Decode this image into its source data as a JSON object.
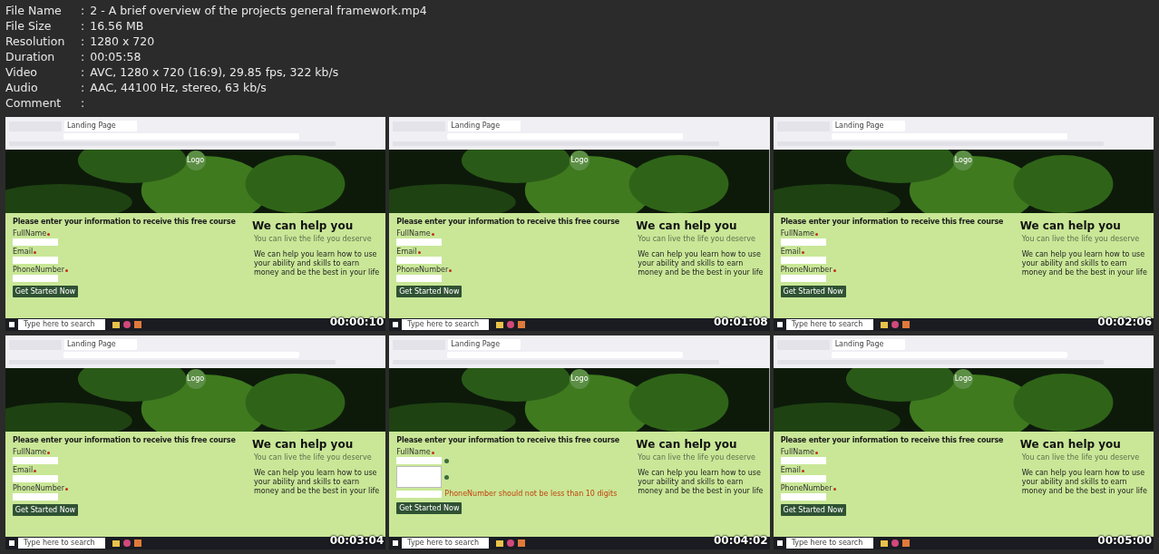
{
  "info": [
    {
      "label": "File Name",
      "sep": ":",
      "value": "2 - A brief overview of the projects general framework.mp4"
    },
    {
      "label": "File Size",
      "sep": ":",
      "value": "16.56 MB"
    },
    {
      "label": "Resolution",
      "sep": ":",
      "value": "1280 x 720"
    },
    {
      "label": "Duration",
      "sep": ":",
      "value": "00:05:58"
    },
    {
      "label": "Video",
      "sep": ":",
      "value": "AVC, 1280 x 720 (16:9), 29.85 fps, 322 kb/s"
    },
    {
      "label": "Audio",
      "sep": ":",
      "value": "AAC, 44100 Hz, stereo, 63 kb/s"
    },
    {
      "label": "Comment",
      "sep": ":"
    }
  ],
  "frames": [
    {
      "tab": "Landing Page",
      "logo": "Logo",
      "form_title": "Please enter your information to receive this free course",
      "fields": [
        {
          "label": "FullName",
          "valid": false
        },
        {
          "label": "Email",
          "valid": false
        },
        {
          "label": "PhoneNumber",
          "valid": false
        }
      ],
      "button": "Get Started Now",
      "headline": "We can help you",
      "subtitle": "You can live the life you deserve",
      "body": "We can help you learn how to use your ability and skills to earn money and be the best in your life",
      "search": "Type here to search",
      "timestamp": "00:00:10"
    },
    {
      "tab": "Landing Page",
      "logo": "Logo",
      "form_title": "Please enter your information to receive this free course",
      "fields": [
        {
          "label": "FullName",
          "valid": false
        },
        {
          "label": "Email",
          "valid": false
        },
        {
          "label": "PhoneNumber",
          "valid": false
        }
      ],
      "button": "Get Started Now",
      "headline": "We can help you",
      "subtitle": "You can live the life you deserve",
      "body": "We can help you learn how to use your ability and skills to earn money and be the best in your life",
      "search": "Type here to search",
      "timestamp": "00:01:08"
    },
    {
      "tab": "Landing Page",
      "logo": "Logo",
      "form_title": "Please enter your information to receive this free course",
      "fields": [
        {
          "label": "FullName",
          "valid": false
        },
        {
          "label": "Email",
          "valid": false
        },
        {
          "label": "PhoneNumber",
          "valid": false
        }
      ],
      "button": "Get Started Now",
      "headline": "We can help you",
      "subtitle": "You can live the life you deserve",
      "body": "We can help you learn how to use your ability and skills to earn money and be the best in your life",
      "search": "Type here to search",
      "timestamp": "00:02:06"
    },
    {
      "tab": "Landing Page",
      "logo": "Logo",
      "form_title": "Please enter your information to receive this free course",
      "fields": [
        {
          "label": "FullName",
          "valid": false
        },
        {
          "label": "Email",
          "valid": false
        },
        {
          "label": "PhoneNumber",
          "valid": false
        }
      ],
      "button": "Get Started Now",
      "headline": "We can help you",
      "subtitle": "You can live the life you deserve",
      "body": "We can help you learn how to use your ability and skills to earn money and be the best in your life",
      "search": "Type here to search",
      "timestamp": "00:03:04"
    },
    {
      "tab": "Landing Page",
      "logo": "Logo",
      "form_title": "Please enter your information to receive this free course",
      "fields": [
        {
          "label": "FullName",
          "valid": true
        },
        {
          "valid": true,
          "suggestions_open": true
        },
        {
          "valid": false,
          "error": "PhoneNumber should not be less than 10 digits"
        }
      ],
      "button": "Get Started Now",
      "headline": "We can help you",
      "subtitle": "You can live the life you deserve",
      "body": "We can help you learn how to use your ability and skills to earn money and be the best in your life",
      "search": "Type here to search",
      "timestamp": "00:04:02"
    },
    {
      "tab": "Landing Page",
      "logo": "Logo",
      "form_title": "Please enter your information to receive this free course",
      "fields": [
        {
          "label": "FullName",
          "valid": false
        },
        {
          "label": "Email",
          "valid": false
        },
        {
          "label": "PhoneNumber",
          "valid": false
        }
      ],
      "button": "Get Started Now",
      "headline": "We can help you",
      "subtitle": "You can live the life you deserve",
      "body": "We can help you learn how to use your ability and skills to earn money and be the best in your life",
      "search": "Type here to search",
      "timestamp": "00:05:00"
    }
  ]
}
